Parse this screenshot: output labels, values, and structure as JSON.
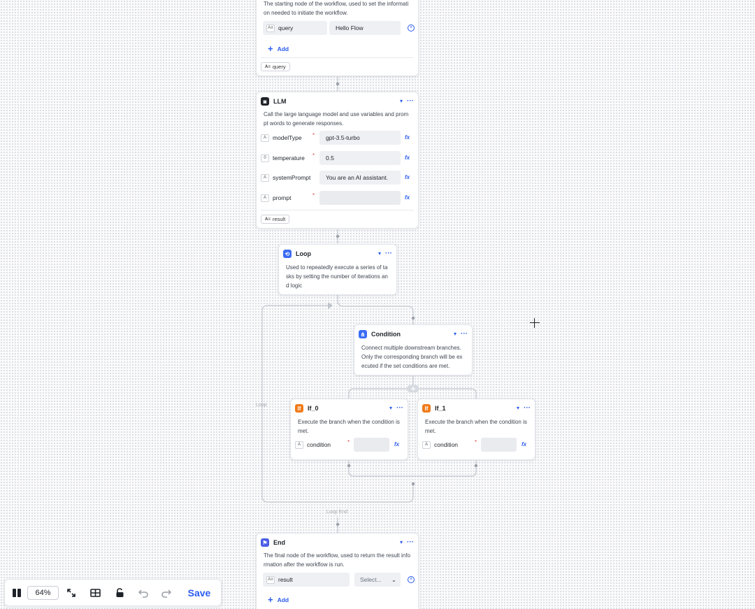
{
  "start_node": {
    "description": "The starting node of the workflow, used to set the information needed to initiate the workflow.",
    "param_name": "query",
    "param_value": "Hello Flow",
    "add_label": "Add",
    "output": "query"
  },
  "llm_node": {
    "title": "LLM",
    "description": "Call the large language model and use variables and prompt words to generate responses.",
    "fields": [
      {
        "name": "modelType",
        "value": "gpt-3.5-turbo",
        "required": true
      },
      {
        "name": "temperature",
        "value": "0.5",
        "required": true
      },
      {
        "name": "systemPrompt",
        "value": "You are an AI assistant.",
        "required": false
      },
      {
        "name": "prompt",
        "value": "",
        "required": true
      }
    ],
    "output": "result"
  },
  "loop_node": {
    "title": "Loop",
    "description": "Used to repeatedly execute a series of tasks by setting the number of iterations and logic"
  },
  "condition_node": {
    "title": "Condition",
    "description": "Connect multiple downstream branches. Only the corresponding branch will be executed if the set conditions are met."
  },
  "branches": [
    {
      "title": "If_0",
      "description": "Execute the branch when the condition is met.",
      "field": "condition"
    },
    {
      "title": "If_1",
      "description": "Execute the branch when the condition is met.",
      "field": "condition"
    }
  ],
  "edge_labels": {
    "loop_side": "Loop",
    "loop_end": "Loop End"
  },
  "end_node": {
    "title": "End",
    "description": "The final node of the workflow, used to return the result information after the workflow is run.",
    "param_name": "result",
    "select_placeholder": "Select...",
    "add_label": "Add"
  },
  "toolbar": {
    "zoom": "64%",
    "save_label": "Save"
  },
  "icons": {
    "minimap": "minimap-icon",
    "fit_view": "expand-icon",
    "layout": "grid-layout-icon",
    "lock": "unlock-icon",
    "undo": "undo-icon",
    "redo": "redo-icon"
  },
  "colors": {
    "accent": "#2b5cf0",
    "llm_icon": "#1f2329",
    "loop_icon": "#3b6cf6",
    "condition_icon": "#3b6cf6",
    "branch_icon": "#f07b1a",
    "end_icon": "#4b5de6",
    "required": "#e5484d"
  }
}
